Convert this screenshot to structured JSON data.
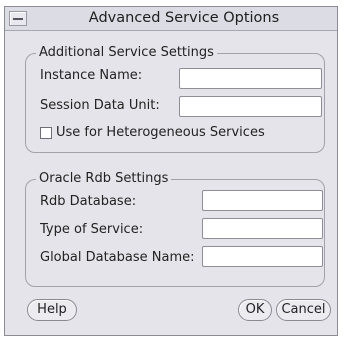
{
  "window": {
    "title": "Advanced Service Options"
  },
  "additional": {
    "legend": "Additional Service Settings",
    "instance_name": {
      "label": "Instance Name:",
      "value": ""
    },
    "session_data_unit": {
      "label": "Session Data Unit:",
      "value": ""
    },
    "heterogeneous": {
      "label": "Use for Heterogeneous Services",
      "checked": false
    }
  },
  "rdb": {
    "legend": "Oracle Rdb Settings",
    "rdb_database": {
      "label": "Rdb Database:",
      "value": ""
    },
    "type_of_service": {
      "label": "Type of Service:",
      "value": ""
    },
    "global_database_name": {
      "label": "Global Database Name:",
      "value": ""
    }
  },
  "buttons": {
    "help": "Help",
    "ok": "OK",
    "cancel": "Cancel"
  },
  "icons": {
    "system_menu": "window-menu-icon"
  },
  "colors": {
    "dialog_bg": "#e4e4ea",
    "field_bg": "#ffffff",
    "border": "#8e8e98"
  }
}
